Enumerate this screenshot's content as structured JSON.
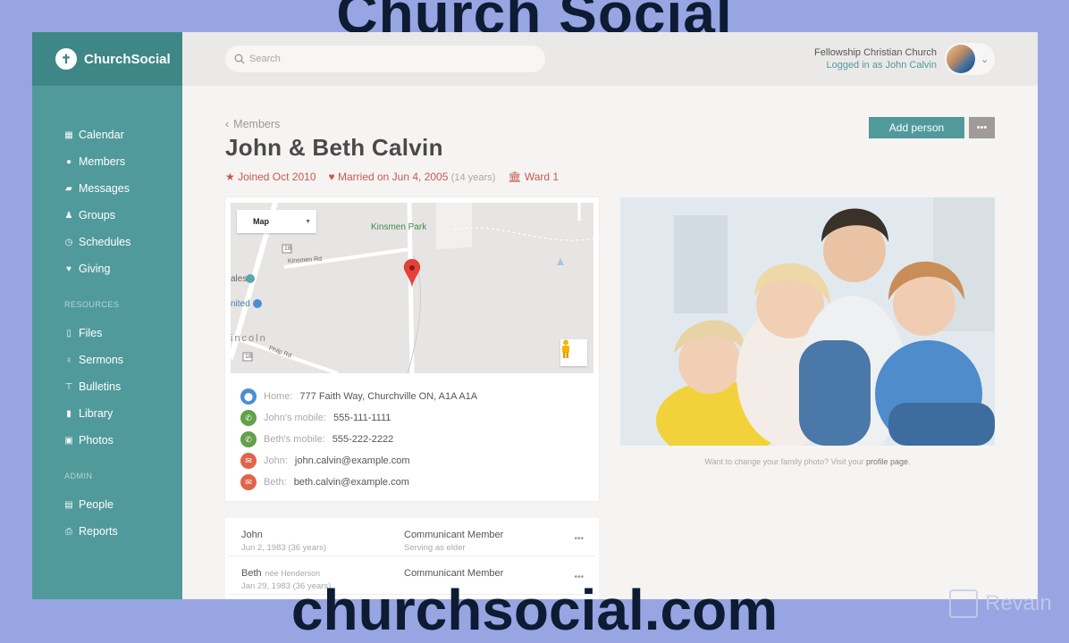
{
  "overlay": {
    "top_banner": "Church Social",
    "bottom_banner": "churchsocial.com",
    "watermark": "Revain"
  },
  "app": {
    "name": "ChurchSocial"
  },
  "sidebar": {
    "items": [
      {
        "label": "Calendar",
        "icon": "calendar-icon"
      },
      {
        "label": "Members",
        "icon": "user-icon",
        "active": true
      },
      {
        "label": "Messages",
        "icon": "messages-icon"
      },
      {
        "label": "Groups",
        "icon": "groups-icon"
      },
      {
        "label": "Schedules",
        "icon": "clock-icon"
      },
      {
        "label": "Giving",
        "icon": "heart-icon"
      }
    ],
    "resources_label": "RESOURCES",
    "resources": [
      {
        "label": "Files",
        "icon": "file-icon"
      },
      {
        "label": "Sermons",
        "icon": "microphone-icon"
      },
      {
        "label": "Bulletins",
        "icon": "pin-icon"
      },
      {
        "label": "Library",
        "icon": "book-icon"
      },
      {
        "label": "Photos",
        "icon": "image-icon"
      }
    ],
    "admin_label": "ADMIN",
    "admin": [
      {
        "label": "People",
        "icon": "address-book-icon"
      },
      {
        "label": "Reports",
        "icon": "printer-icon"
      }
    ]
  },
  "header": {
    "search_placeholder": "Search",
    "church_name": "Fellowship Christian Church",
    "logged_in": "Logged in as John Calvin"
  },
  "page": {
    "breadcrumb": "Members",
    "title": "John & Beth Calvin",
    "joined": "Joined Oct 2010",
    "married": "Married on Jun 4, 2005",
    "married_years": "(14 years)",
    "ward": "Ward 1",
    "add_person": "Add person",
    "more": "•••"
  },
  "map": {
    "type_select": "Map",
    "labels": {
      "park": "Kinsmen Park",
      "road1": "Kinsmen Rd",
      "road2": "Philp Rd",
      "town": "incoln",
      "place1": "ales",
      "place2": "nited",
      "route": "18"
    }
  },
  "contacts": [
    {
      "label": "Home:",
      "value": "777 Faith Way, Churchville ON, A1A A1A",
      "type": "location"
    },
    {
      "label": "John's mobile:",
      "value": "555-111-1111",
      "type": "phone"
    },
    {
      "label": "Beth's mobile:",
      "value": "555-222-2222",
      "type": "phone"
    },
    {
      "label": "John:",
      "value": "john.calvin@example.com",
      "type": "email"
    },
    {
      "label": "Beth:",
      "value": "beth.calvin@example.com",
      "type": "email"
    }
  ],
  "members": [
    {
      "name": "John",
      "nee": "",
      "dob": "Jun 2, 1983 (36 years)",
      "role": "Communicant Member",
      "sub": "Serving as elder"
    },
    {
      "name": "Beth",
      "nee": "née Henderson",
      "dob": "Jan 29, 1983 (36 years)",
      "role": "Communicant Member",
      "sub": ""
    }
  ],
  "photo": {
    "caption": "Want to change your family photo? Visit your",
    "link": "profile page",
    "caption_end": "."
  }
}
